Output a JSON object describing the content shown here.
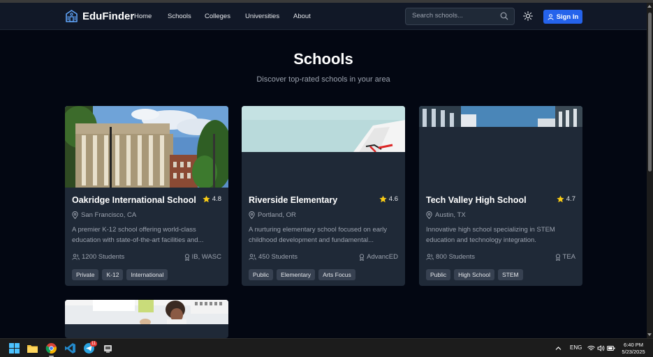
{
  "app": {
    "name": "EduFinder",
    "nav": [
      "Home",
      "Schools",
      "Colleges",
      "Universities",
      "About"
    ],
    "search_placeholder": "Search schools...",
    "signin_label": "Sign In",
    "accent": "#2563eb"
  },
  "page": {
    "title": "Schools",
    "subtitle": "Discover top-rated schools in your area"
  },
  "schools": [
    {
      "name": "Oakridge International School",
      "rating": "4.8",
      "location": "San Francisco, CA",
      "description": "A premier K-12 school offering world-class education with state-of-the-art facilities and...",
      "students": "1200 Students",
      "accreditation": "IB, WASC",
      "tags": [
        "Private",
        "K-12",
        "International"
      ]
    },
    {
      "name": "Riverside Elementary",
      "rating": "4.6",
      "location": "Portland, OR",
      "description": "A nurturing elementary school focused on early childhood development and fundamental...",
      "students": "450 Students",
      "accreditation": "AdvancED",
      "tags": [
        "Public",
        "Elementary",
        "Arts Focus"
      ]
    },
    {
      "name": "Tech Valley High School",
      "rating": "4.7",
      "location": "Austin, TX",
      "description": "Innovative high school specializing in STEM education and technology integration.",
      "students": "800 Students",
      "accreditation": "TEA",
      "tags": [
        "Public",
        "High School",
        "STEM"
      ]
    }
  ],
  "taskbar": {
    "language": "ENG",
    "time": "6:40 PM",
    "date": "5/23/2025",
    "telegram_badge": "11"
  }
}
